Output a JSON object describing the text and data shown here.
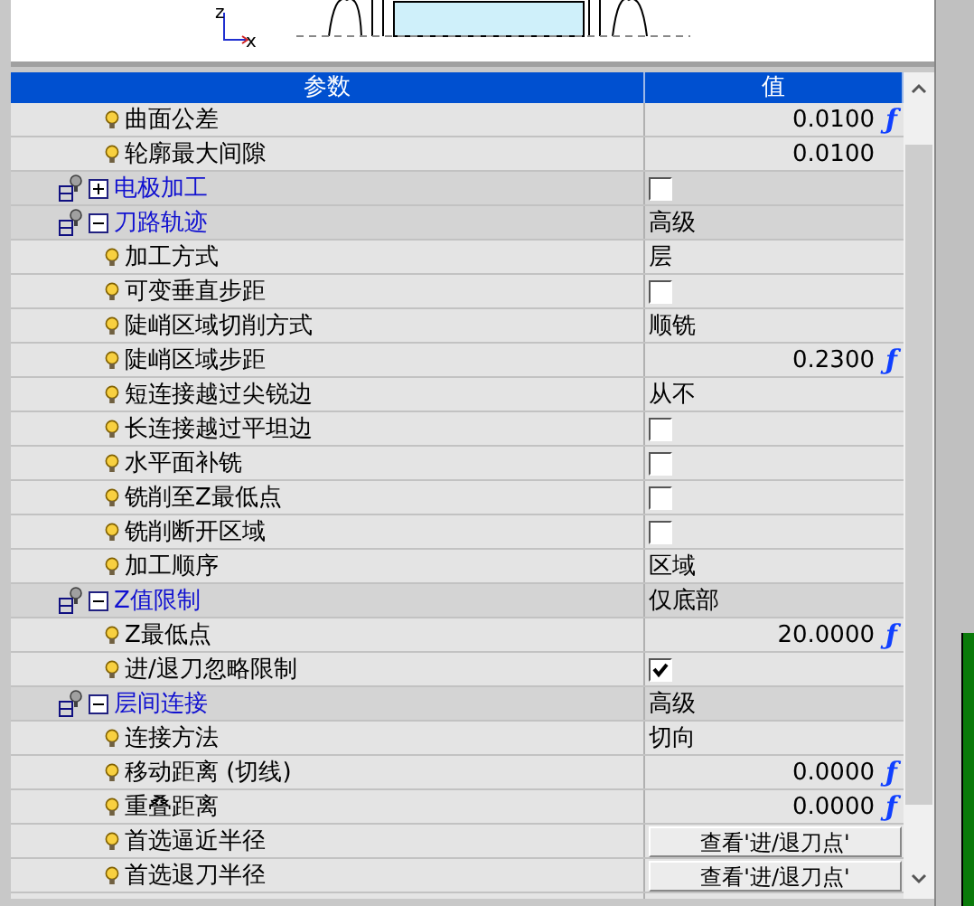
{
  "preview": {
    "axis_labels": [
      "z",
      "x"
    ]
  },
  "header": [
    "参数",
    "值"
  ],
  "rows": [
    {
      "kind": "leaf",
      "label": "曲面公差",
      "value": {
        "kind": "number",
        "text": "0.0100",
        "suffix": "ƒ"
      }
    },
    {
      "kind": "leaf",
      "label": "轮廓最大间隙",
      "value": {
        "kind": "number",
        "text": "0.0100"
      }
    },
    {
      "kind": "group",
      "label": "电极加工",
      "expanded": false,
      "value": {
        "kind": "checkbox",
        "checked": false
      }
    },
    {
      "kind": "group",
      "label": "刀路轨迹",
      "expanded": true,
      "value": {
        "kind": "text",
        "text": "高级"
      },
      "children": [
        {
          "kind": "leaf",
          "label": "加工方式",
          "value": {
            "kind": "text",
            "text": "层"
          }
        },
        {
          "kind": "leaf",
          "label": "可变垂直步距",
          "value": {
            "kind": "checkbox",
            "checked": false
          }
        },
        {
          "kind": "leaf",
          "label": "陡峭区域切削方式",
          "value": {
            "kind": "text",
            "text": "顺铣"
          }
        },
        {
          "kind": "leaf",
          "label": "陡峭区域步距",
          "value": {
            "kind": "number",
            "text": "0.2300",
            "suffix": "ƒ"
          }
        },
        {
          "kind": "leaf",
          "label": "短连接越过尖锐边",
          "value": {
            "kind": "text",
            "text": "从不"
          }
        },
        {
          "kind": "leaf",
          "label": "长连接越过平坦边",
          "value": {
            "kind": "checkbox",
            "checked": false
          }
        },
        {
          "kind": "leaf",
          "label": "水平面补铣",
          "value": {
            "kind": "checkbox",
            "checked": false
          }
        },
        {
          "kind": "leaf",
          "label": "铣削至Z最低点",
          "value": {
            "kind": "checkbox",
            "checked": false
          }
        },
        {
          "kind": "leaf",
          "label": "铣削断开区域",
          "value": {
            "kind": "checkbox",
            "checked": false
          }
        },
        {
          "kind": "leaf",
          "label": "加工顺序",
          "value": {
            "kind": "text",
            "text": "区域"
          }
        }
      ]
    },
    {
      "kind": "group",
      "label": "Z值限制",
      "expanded": true,
      "value": {
        "kind": "text",
        "text": "仅底部"
      },
      "children": [
        {
          "kind": "leaf",
          "label": "Z最低点",
          "value": {
            "kind": "number",
            "text": "20.0000",
            "suffix": "ƒ"
          }
        },
        {
          "kind": "leaf",
          "label": "进/退刀忽略限制",
          "value": {
            "kind": "checkbox",
            "checked": true
          }
        }
      ]
    },
    {
      "kind": "group",
      "label": "层间连接",
      "expanded": true,
      "value": {
        "kind": "text",
        "text": "高级"
      },
      "children": [
        {
          "kind": "leaf",
          "label": "连接方法",
          "value": {
            "kind": "text",
            "text": "切向"
          }
        },
        {
          "kind": "leaf",
          "label": "移动距离 (切线)",
          "value": {
            "kind": "number",
            "text": "0.0000",
            "suffix": "ƒ"
          }
        },
        {
          "kind": "leaf",
          "label": "重叠距离",
          "value": {
            "kind": "number",
            "text": "0.0000",
            "suffix": "ƒ"
          }
        },
        {
          "kind": "leaf",
          "label": "首选逼近半径",
          "value": {
            "kind": "button",
            "text": "查看'进/退刀点'"
          }
        },
        {
          "kind": "leaf",
          "label": "首选退刀半径",
          "value": {
            "kind": "button",
            "text": "查看'进/退刀点'"
          }
        }
      ]
    }
  ]
}
